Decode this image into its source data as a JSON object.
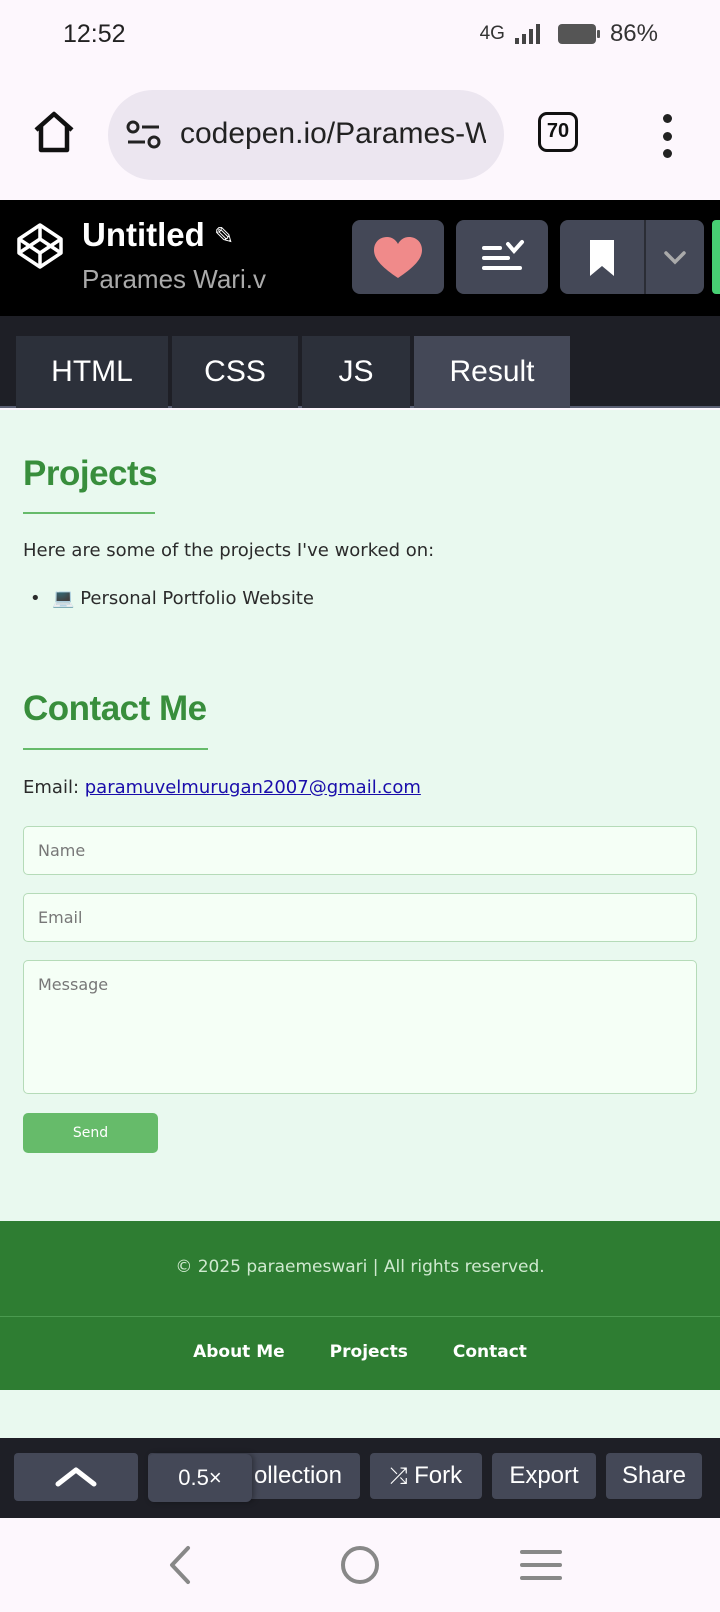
{
  "status_bar": {
    "time": "12:52",
    "network": "4G",
    "battery": "86%"
  },
  "browser": {
    "url": "codepen.io/Parames-W",
    "tab_count": "70"
  },
  "codepen": {
    "title": "Untitled",
    "author": "Parames Wari.v",
    "tabs": [
      "HTML",
      "CSS",
      "JS",
      "Result"
    ]
  },
  "result": {
    "projects": {
      "heading": "Projects",
      "intro": "Here are some of the projects I've worked on:",
      "items": [
        "💻 Personal Portfolio Website"
      ]
    },
    "contact": {
      "heading": "Contact Me",
      "email_label": "Email: ",
      "email": "paramuvelmurugan2007@gmail.com",
      "name_placeholder": "Name",
      "email_placeholder": "Email",
      "message_placeholder": "Message",
      "send_label": "Send"
    },
    "footer": {
      "copyright": "© 2025 paraemeswari | All rights reserved.",
      "links": [
        "About Me",
        "Projects",
        "Contact"
      ]
    }
  },
  "bottom_bar": {
    "zoom": "0.5×",
    "collection": "ollection",
    "fork": "Fork",
    "export": "Export",
    "share": "Share"
  }
}
